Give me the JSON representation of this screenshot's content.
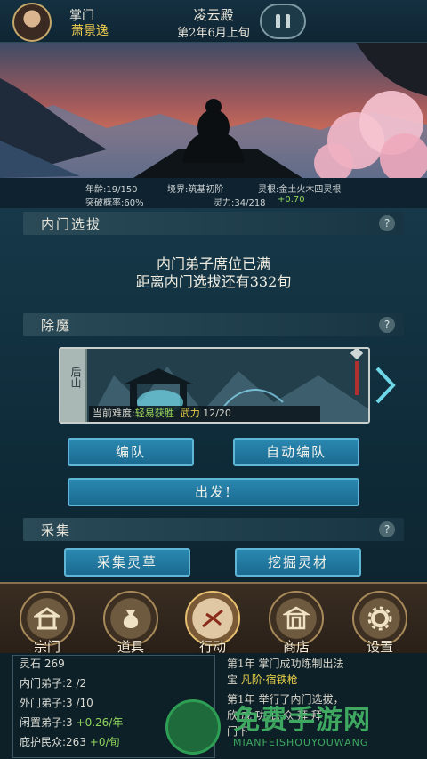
{
  "header": {
    "role_label": "掌门",
    "leader_name": "萧景逸",
    "sect_name": "凌云殿",
    "date": "第2年6月上旬"
  },
  "stats": {
    "age": "年龄:19/150",
    "realm": "境界:筑基初阶",
    "spirit_root": "灵根:金土火木四灵根",
    "breakthrough": "突破概率:60%",
    "spirit_power": "灵力:34/218",
    "spirit_rate": "+0.70"
  },
  "inner_selection": {
    "title": "内门选拔",
    "line1": "内门弟子席位已满",
    "line2": "距离内门选拔还有332旬",
    "help": "?"
  },
  "demon": {
    "title": "除魔",
    "help": "?",
    "location": "后山",
    "difficulty_label": "当前难度:",
    "difficulty_value": "轻易获胜",
    "power_label": "武力",
    "power_value": "12/20",
    "formation_button": "编队",
    "auto_formation_button": "自动编队",
    "depart_button": "出发!"
  },
  "gather": {
    "title": "采集",
    "help": "?",
    "herb_button": "采集灵草",
    "ore_button": "挖掘灵材"
  },
  "nav": {
    "items": [
      {
        "label": "宗门",
        "icon": "sect-icon"
      },
      {
        "label": "道具",
        "icon": "bag-icon"
      },
      {
        "label": "行动",
        "icon": "action-icon"
      },
      {
        "label": "商店",
        "icon": "shop-icon"
      },
      {
        "label": "设置",
        "icon": "gear-icon"
      }
    ],
    "active": "行动"
  },
  "resources": {
    "spirit_stone": "灵石 269",
    "inner_disciples": "内门弟子:2 /2",
    "outer_disciples": "外门弟子:3 /10",
    "idle_disciples": "闲置弟子:3",
    "idle_rate": "+0.26/年",
    "protected": "庇护民众:263",
    "protected_rate": "+0/旬"
  },
  "log": {
    "line1": "第1年 掌门成功炼制出法",
    "line2_a": "宝",
    "line2_b": "凡阶·宿铁枪",
    "line3": "第1年 举行了内门选拔，",
    "line4": "欣 成 功 庇 众 拜 拜",
    "line5": "门下"
  },
  "watermark": {
    "text": "免费手游网",
    "sub": "MIANFEISHOUYOUWANG"
  },
  "colors": {
    "gold": "#f1cc4d",
    "green": "#8fd45a",
    "button_blue": "#2a88b0"
  }
}
